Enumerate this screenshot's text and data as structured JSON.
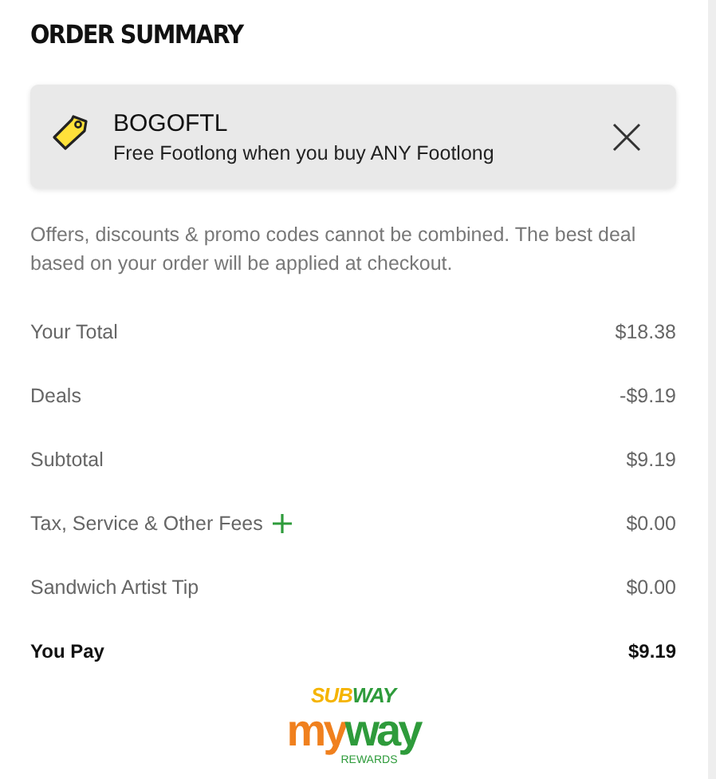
{
  "title": "ORDER SUMMARY",
  "promo": {
    "code": "BOGOFTL",
    "description": "Free Footlong when you buy ANY Footlong"
  },
  "notice": "Offers, discounts & promo codes cannot be combined. The best deal based on your order will be applied at checkout.",
  "lines": [
    {
      "kind": "plain",
      "label": "Your Total",
      "amount": "$18.38"
    },
    {
      "kind": "plain",
      "label": "Deals",
      "amount": "-$9.19"
    },
    {
      "kind": "plain",
      "label": "Subtotal",
      "amount": "$9.19"
    },
    {
      "kind": "expandable",
      "label": "Tax, Service & Other Fees",
      "amount": "$0.00"
    },
    {
      "kind": "plain",
      "label": "Sandwich Artist Tip",
      "amount": "$0.00"
    },
    {
      "kind": "total",
      "label": "You Pay",
      "amount": "$9.19"
    }
  ],
  "logo": {
    "brand": [
      {
        "text": "SUB",
        "color": "#f5b400"
      },
      {
        "text": "WAY",
        "color": "#2e9b3b"
      }
    ],
    "program": [
      {
        "text": "my",
        "color": "#f0801e"
      },
      {
        "text": "way",
        "color": "#2e9b3b"
      }
    ],
    "tagline": "REWARDS"
  }
}
